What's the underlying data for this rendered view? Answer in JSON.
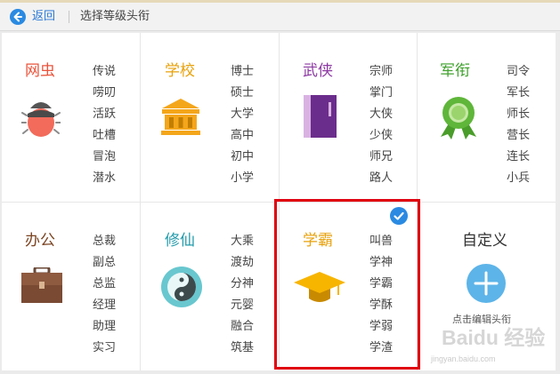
{
  "topbar": {
    "back_label": "返回",
    "page_title": "选择等级头衔"
  },
  "categories": [
    {
      "name": "网虫",
      "color": "#e9543c",
      "icon": "bug-icon",
      "titles": [
        "传说",
        "唠叨",
        "活跃",
        "吐槽",
        "冒泡",
        "潜水"
      ]
    },
    {
      "name": "学校",
      "color": "#e8a20c",
      "icon": "school-building-icon",
      "titles": [
        "博士",
        "硕士",
        "大学",
        "高中",
        "初中",
        "小学"
      ]
    },
    {
      "name": "武侠",
      "color": "#8d3aa3",
      "icon": "martial-book-icon",
      "titles": [
        "宗师",
        "掌门",
        "大侠",
        "少侠",
        "师兄",
        "路人"
      ]
    },
    {
      "name": "军衔",
      "color": "#3fa12c",
      "icon": "military-medal-icon",
      "titles": [
        "司令",
        "军长",
        "师长",
        "营长",
        "连长",
        "小兵"
      ]
    },
    {
      "name": "办公",
      "color": "#7a4320",
      "icon": "briefcase-icon",
      "titles": [
        "总裁",
        "副总",
        "总监",
        "经理",
        "助理",
        "实习"
      ]
    },
    {
      "name": "修仙",
      "color": "#239bab",
      "icon": "yin-yang-icon",
      "titles": [
        "大乘",
        "渡劫",
        "分神",
        "元婴",
        "融合",
        "筑基"
      ]
    },
    {
      "name": "学霸",
      "color": "#e8a20c",
      "icon": "graduation-cap-icon",
      "titles": [
        "叫兽",
        "学神",
        "学霸",
        "学酥",
        "学弱",
        "学渣"
      ],
      "selected": true
    }
  ],
  "custom": {
    "title": "自定义",
    "hint": "点击编辑头衔",
    "icon": "plus-icon"
  },
  "watermark": {
    "text": "Baidu 经验",
    "url": "jingyan.baidu.com"
  },
  "colors": {
    "accent_blue": "#2a8ae2",
    "selected_border": "#e0000f"
  }
}
